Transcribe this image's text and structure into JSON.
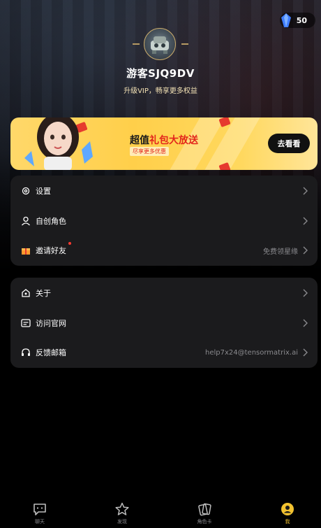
{
  "wallet": {
    "gem_icon": "blue-crystal-icon",
    "balance": "50"
  },
  "profile": {
    "avatar_icon": "robot-avatar",
    "username": "游客SJQ9DV",
    "vip_tip": "升级VIP，畅享更多权益"
  },
  "banner": {
    "title_part1": "超值",
    "title_highlight": "礼包大放送",
    "subtitle": "尽享更多优惠",
    "button_label": "去看看",
    "highlight_color": "#e3261c",
    "bg_color": "#ffd24f"
  },
  "menu_group_1": [
    {
      "icon": "gear-icon",
      "label": "设置",
      "right_text": ""
    },
    {
      "icon": "user-icon",
      "label": "自创角色",
      "right_text": ""
    },
    {
      "icon": "gift-icon",
      "label": "邀请好友",
      "right_text": "免费领星缘",
      "badge": "red-dot"
    }
  ],
  "menu_group_2": [
    {
      "icon": "info-icon",
      "label": "关于",
      "right_text": ""
    },
    {
      "icon": "browser-icon",
      "label": "访问官网",
      "right_text": ""
    },
    {
      "icon": "headset-icon",
      "label": "反馈邮箱",
      "right_text": "help7x24@tensormatrix.ai"
    }
  ],
  "tabbar": {
    "items": [
      {
        "icon": "chat-icon",
        "label": "聊天"
      },
      {
        "icon": "star-icon",
        "label": "发现"
      },
      {
        "icon": "cards-icon",
        "label": "角色卡"
      },
      {
        "icon": "profile-icon",
        "label": "我",
        "active": true
      }
    ],
    "active_color": "#f2c230"
  }
}
